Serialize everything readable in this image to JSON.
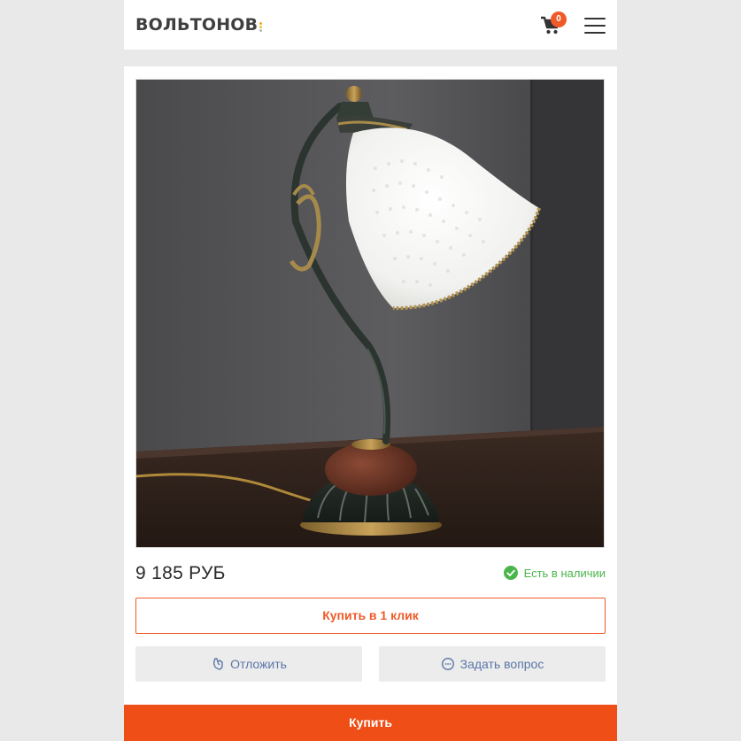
{
  "header": {
    "logo_text": "ВОЛЬТОНОВ",
    "logo_dot_colors": [
      "#f5a623",
      "#f5c623",
      "#b9b9b9"
    ],
    "cart_icon": "cart-icon",
    "cart_count": "0",
    "menu_icon": "hamburger-menu-icon"
  },
  "product": {
    "image": "table-lamp-photo",
    "price": "9 185 РУБ",
    "stock_icon": "check-circle-icon",
    "stock_text": "Есть в наличии"
  },
  "actions": {
    "one_click_label": "Купить в 1 клик",
    "defer_label": "Отложить",
    "defer_icon": "defer-icon",
    "ask_label": "Задать вопрос",
    "ask_icon": "chat-icon",
    "buy_label": "Купить"
  },
  "colors": {
    "accent": "#ef5a28",
    "stock_green": "#4ab54a",
    "secondary_text": "#5a76a8",
    "page_bg": "#e9e9e9"
  }
}
